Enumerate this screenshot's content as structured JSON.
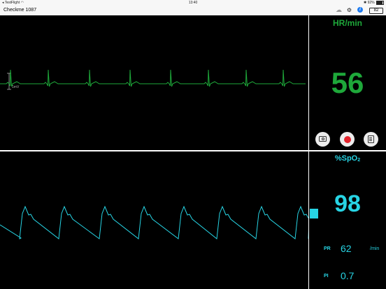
{
  "status_bar": {
    "carrier": "TestFlight",
    "wifi_icon": "wifi-icon",
    "time": "13:40",
    "battery_percent": "92%"
  },
  "nav": {
    "title": "Checkme 1087",
    "icons": [
      "cloud-icon",
      "gear-icon",
      "info-icon"
    ],
    "info_glyph": "i",
    "battery_badge": "82"
  },
  "ecg": {
    "scale_label": "1mV",
    "color": "#1ea83a"
  },
  "hr": {
    "label": "HR/min",
    "value": "56",
    "color": "#1ea83a"
  },
  "actions": [
    "camera-icon",
    "record-icon",
    "list-icon"
  ],
  "spo2": {
    "label_main": "%SpO",
    "label_sub": "2",
    "value": "98",
    "color": "#27d4e4"
  },
  "pr": {
    "label": "PR",
    "value": "62",
    "unit": "/min"
  },
  "pi": {
    "label": "PI",
    "value": "0.7"
  },
  "colors": {
    "background": "#000000",
    "frame": "#ffffff",
    "record": "#e3232c"
  }
}
